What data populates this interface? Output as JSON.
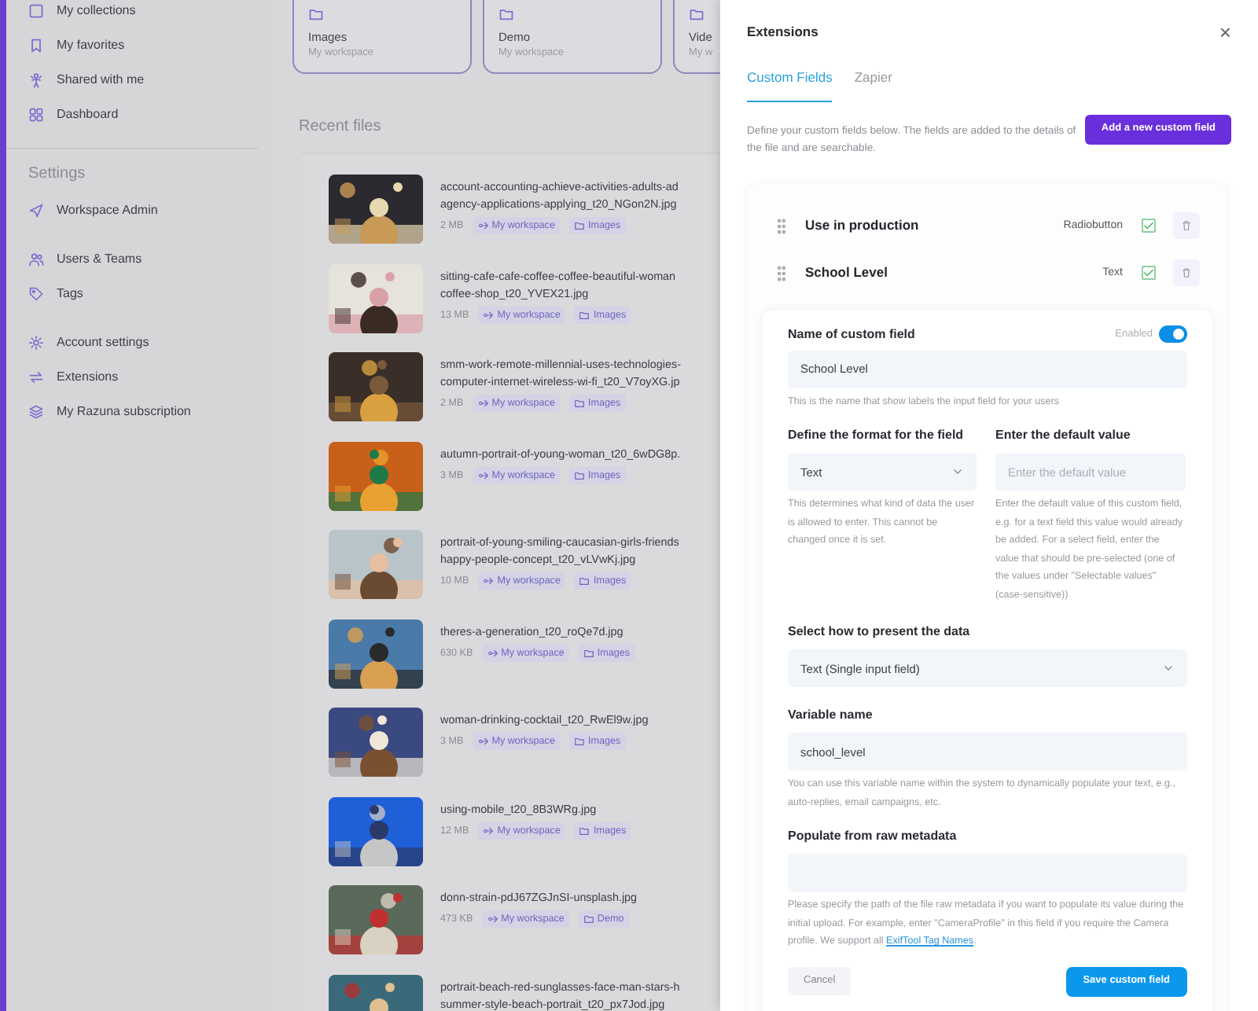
{
  "sidebar": {
    "top_items": [
      {
        "label": "My collections"
      },
      {
        "label": "My favorites"
      },
      {
        "label": "Shared with me"
      },
      {
        "label": "Dashboard"
      }
    ],
    "settings_heading": "Settings",
    "settings_groups": [
      [
        {
          "label": "Workspace Admin"
        }
      ],
      [
        {
          "label": "Users & Teams"
        },
        {
          "label": "Tags"
        }
      ],
      [
        {
          "label": "Account settings"
        },
        {
          "label": "Extensions"
        },
        {
          "label": "My Razuna subscription"
        }
      ]
    ]
  },
  "folders": [
    {
      "name": "Images",
      "workspace": "My workspace"
    },
    {
      "name": "Demo",
      "workspace": "My workspace"
    },
    {
      "name": "Vide",
      "workspace": "My w"
    }
  ],
  "recent_files": {
    "title": "Recent files",
    "files": [
      {
        "name_lines": [
          "account-accounting-achieve-activities-adults-ad",
          "agency-applications-applying_t20_NGon2N.jpg"
        ],
        "size": "2 MB",
        "workspace": "My workspace",
        "folder": "Images"
      },
      {
        "name_lines": [
          "sitting-cafe-cafe-coffee-coffee-beautiful-woman",
          "coffee-shop_t20_YVEX21.jpg"
        ],
        "size": "13 MB",
        "workspace": "My workspace",
        "folder": "Images"
      },
      {
        "name_lines": [
          "smm-work-remote-millennial-uses-technologies-",
          "computer-internet-wireless-wi-fi_t20_V7oyXG.jp"
        ],
        "size": "2 MB",
        "workspace": "My workspace",
        "folder": "Images"
      },
      {
        "name_lines": [
          "autumn-portrait-of-young-woman_t20_6wDG8p."
        ],
        "size": "3 MB",
        "workspace": "My workspace",
        "folder": "Images"
      },
      {
        "name_lines": [
          "portrait-of-young-smiling-caucasian-girls-friends",
          "happy-people-concept_t20_vLVwKj.jpg"
        ],
        "size": "10 MB",
        "workspace": "My workspace",
        "folder": "Images"
      },
      {
        "name_lines": [
          "theres-a-generation_t20_roQe7d.jpg"
        ],
        "size": "630 KB",
        "workspace": "My workspace",
        "folder": "Images"
      },
      {
        "name_lines": [
          "woman-drinking-cocktail_t20_RwEl9w.jpg"
        ],
        "size": "3 MB",
        "workspace": "My workspace",
        "folder": "Images"
      },
      {
        "name_lines": [
          "using-mobile_t20_8B3WRg.jpg"
        ],
        "size": "12 MB",
        "workspace": "My workspace",
        "folder": "Images"
      },
      {
        "name_lines": [
          "donn-strain-pdJ67ZGJnSI-unsplash.jpg"
        ],
        "size": "473 KB",
        "workspace": "My workspace",
        "folder": "Demo"
      },
      {
        "name_lines": [
          "portrait-beach-red-sunglasses-face-man-stars-h",
          "summer-style-beach-portrait_t20_px7Jod.jpg"
        ]
      }
    ]
  },
  "extensions_panel": {
    "title": "Extensions",
    "close": "×",
    "tabs": [
      {
        "label": "Custom Fields",
        "selected": true
      },
      {
        "label": "Zapier",
        "selected": false
      }
    ],
    "description": "Define your custom fields below. The fields are added to the details of the file and are searchable.",
    "add_button": "Add a new custom field",
    "fields": [
      {
        "name": "Use in production",
        "type": "Radiobutton",
        "checked": true
      },
      {
        "name": "School Level",
        "type": "Text",
        "checked": true
      }
    ],
    "form": {
      "name_label": "Name of custom field",
      "enabled_label": "Enabled",
      "enabled": true,
      "name_value": "School Level",
      "name_help": "This is the name that show labels the input field for your users",
      "format_label": "Define the format for the field",
      "format_value": "Text",
      "format_help": "This determines what kind of data the user is allowed to enter. This cannot be changed once it is set.",
      "default_label": "Enter the default value",
      "default_placeholder": "Enter the default value",
      "default_help": "Enter the default value of this custom field, e.g. for a text field this value would already be added. For a select field, enter the value that should be pre-selected (one of the values under \"Selectable values\" (case-sensitive))",
      "present_label": "Select how to present the data",
      "present_value": "Text (Single input field)",
      "variable_label": "Variable name",
      "variable_value": "school_level",
      "variable_help": "You can use this variable name within the system to dynamically populate your text, e.g., auto-replies, email campaigns, etc.",
      "metadata_label": "Populate from raw metadata",
      "metadata_help": "Please specify the path of the file raw metadata if you want to populate its value during the initial upload. For example, enter \"CameraProfile\" in this field if you require the Camera profile. We support all ",
      "metadata_link": "ExifTool Tag Names",
      "metadata_help_end": ".",
      "cancel_button": "Cancel",
      "save_button": "Save custom field"
    }
  }
}
